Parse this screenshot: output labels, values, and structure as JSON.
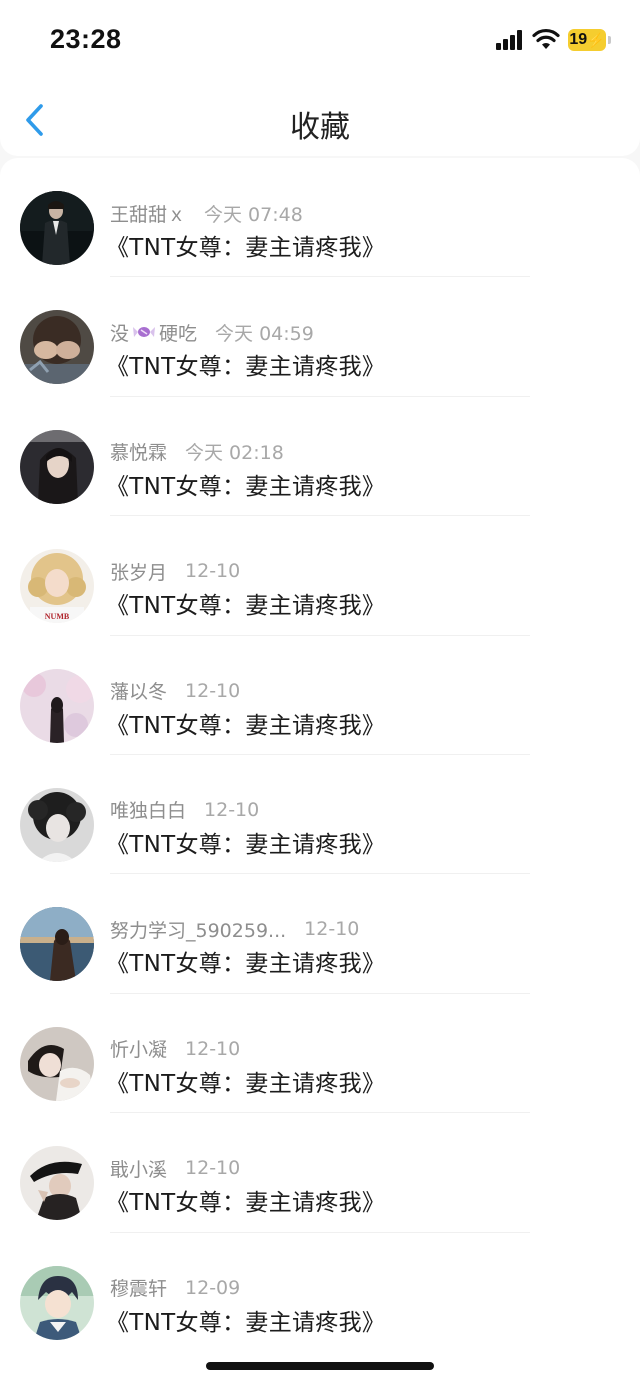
{
  "status_bar": {
    "time": "23:28",
    "battery": "19",
    "icons": [
      "signal-icon",
      "wifi-icon",
      "battery-charging-icon"
    ]
  },
  "nav": {
    "title": "收藏",
    "back_icon": "chevron-left-icon",
    "accent_color": "#2f9bea"
  },
  "favorites": [
    {
      "name": "王甜甜ｘ",
      "time": "今天 07:48",
      "title": "《TNT女尊：妻主请疼我》",
      "avatar": "man-in-suit-dark-room"
    },
    {
      "name": "没",
      "name_suffix": "硬吃",
      "emoji": "candy-icon",
      "time": "今天 04:59",
      "title": "《TNT女尊：妻主请疼我》",
      "avatar": "person-hands-over-face"
    },
    {
      "name": "慕悦霖",
      "time": "今天 02:18",
      "title": "《TNT女尊：妻主请疼我》",
      "avatar": "woman-dark-portrait"
    },
    {
      "name": "张岁月",
      "time": "12-10",
      "title": "《TNT女尊：妻主请疼我》",
      "avatar": "blonde-girl-curly-hair"
    },
    {
      "name": "藩以冬",
      "time": "12-10",
      "title": "《TNT女尊：妻主请疼我》",
      "avatar": "girl-pink-blossoms"
    },
    {
      "name": "唯独白白",
      "time": "12-10",
      "title": "《TNT女尊：妻主请疼我》",
      "avatar": "boy-curly-hair-bw"
    },
    {
      "name": "努力学习_590259...",
      "time": "12-10",
      "title": "《TNT女尊：妻主请疼我》",
      "avatar": "woman-sea-sunset"
    },
    {
      "name": "忻小凝",
      "time": "12-10",
      "title": "《TNT女尊：妻主请疼我》",
      "avatar": "girl-lying-white-shirt"
    },
    {
      "name": "戢小溪",
      "time": "12-10",
      "title": "《TNT女尊：妻主请疼我》",
      "avatar": "man-black-cap"
    },
    {
      "name": "穆震轩",
      "time": "12-09",
      "title": "《TNT女尊：妻主请疼我》",
      "avatar": "anime-boy-illustration"
    }
  ]
}
